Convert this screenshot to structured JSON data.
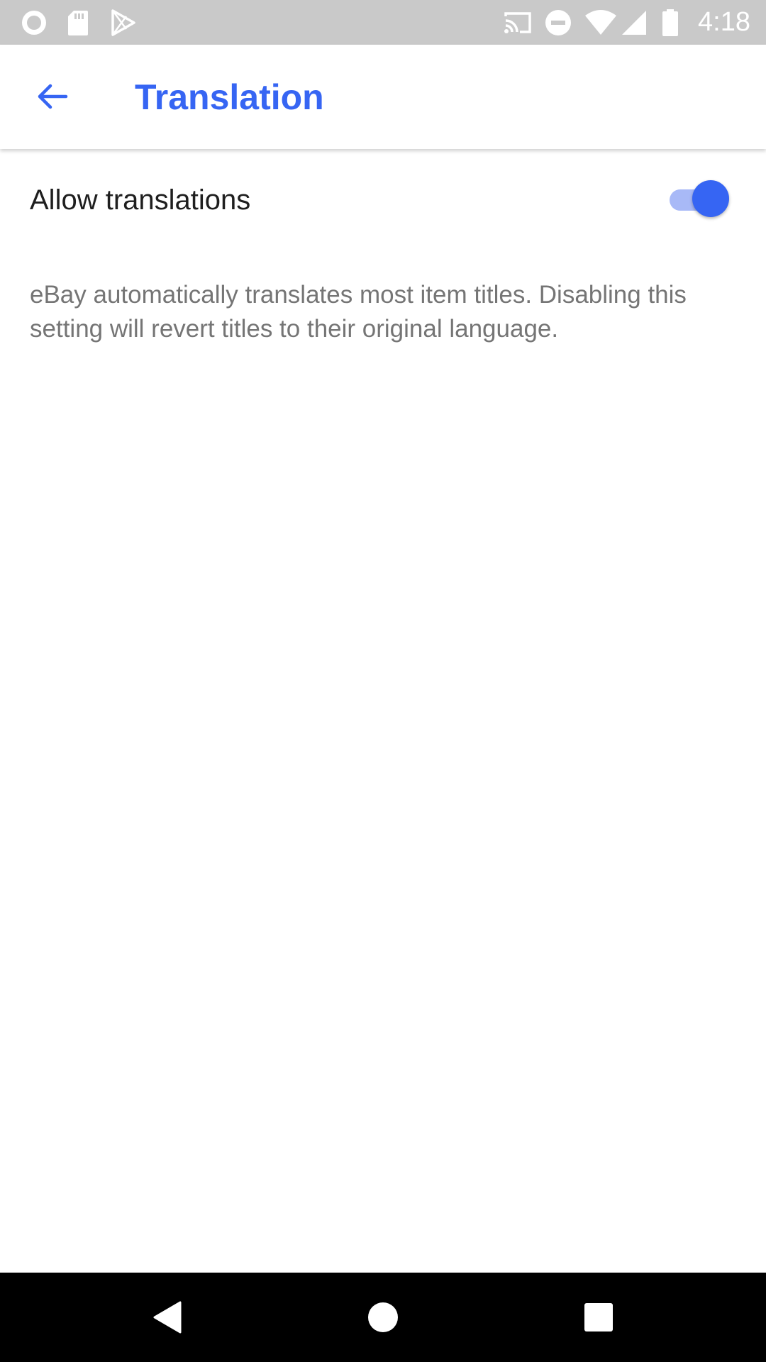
{
  "status_bar": {
    "time": "4:18",
    "left_icons": [
      "record-icon",
      "sd-card-icon",
      "play-store-icon"
    ],
    "right_icons": [
      "cast-icon",
      "do-not-disturb-icon",
      "wifi-icon",
      "signal-icon",
      "battery-icon"
    ]
  },
  "app_bar": {
    "back_icon": "arrow-left-icon",
    "title": "Translation"
  },
  "settings": {
    "allow_translations": {
      "label": "Allow translations",
      "enabled": true
    },
    "description": "eBay automatically translates most item titles. Disabling this setting will revert titles to their original language."
  },
  "nav_bar": {
    "buttons": [
      "back-triangle-icon",
      "home-circle-icon",
      "recents-square-icon"
    ]
  },
  "colors": {
    "accent": "#3665f3",
    "toggle_track": "#a8b9f7",
    "status_bar_bg": "#c9c9c9",
    "nav_bar_bg": "#000000",
    "label_text": "#1f1f1f",
    "description_text": "#757575"
  }
}
